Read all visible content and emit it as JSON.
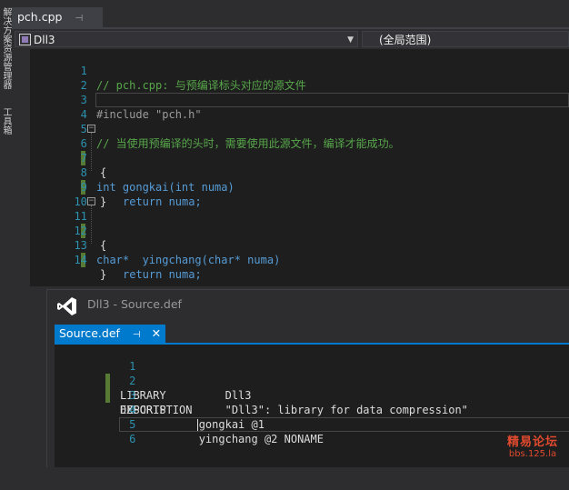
{
  "sidebar": {
    "items": [
      {
        "label": "解决方案资源管理器"
      },
      {
        "label": "工具箱"
      }
    ]
  },
  "doc_tab": {
    "label": "pch.cpp",
    "pin": "⊣"
  },
  "nav": {
    "project": "Dll3",
    "scope": "(全局范围)"
  },
  "code": {
    "lines": [
      {
        "n": "1",
        "text": "// pch.cpp: 与预编译标头对应的源文件"
      },
      {
        "n": "2",
        "text": ""
      },
      {
        "n": "3",
        "text": "#include \"pch.h\""
      },
      {
        "n": "4",
        "text": ""
      },
      {
        "n": "5",
        "text": "// 当使用预编译的头时，需要使用此源文件，编译才能成功。"
      },
      {
        "n": "6",
        "text": "int gongkai(int numa)"
      },
      {
        "n": "7",
        "text": "{"
      },
      {
        "n": "8",
        "text": "return numa;"
      },
      {
        "n": "9",
        "text": "}"
      },
      {
        "n": "10",
        "text": ""
      },
      {
        "n": "11",
        "text": "char*  yingchang(char* numa)"
      },
      {
        "n": "12",
        "text": "{"
      },
      {
        "n": "13",
        "text": "return numa;"
      },
      {
        "n": "14",
        "text": "}"
      }
    ]
  },
  "float_panel": {
    "title": "Dll3 - Source.def",
    "tab_label": "Source.def",
    "pin": "⊣",
    "close": "✕",
    "lines": [
      {
        "n": "1",
        "text": "LIBRARY         Dll3"
      },
      {
        "n": "2",
        "text": "DESCRIPTION     \"Dll3\": library for data compression\""
      },
      {
        "n": "3",
        "text": "EXPORTS"
      },
      {
        "n": "4",
        "text": "            gongkai @1"
      },
      {
        "n": "5",
        "text": "            yingchang @2 NONAME"
      },
      {
        "n": "6",
        "text": ""
      }
    ]
  },
  "watermark": {
    "line1": "精易论坛",
    "line2": "bbs.125.la"
  },
  "colors": {
    "accent": "#007acc",
    "comment": "#57a64a",
    "keyword": "#569cd6",
    "string": "#d69d85",
    "linenum": "#2b91af"
  },
  "icons": [
    "project-icon",
    "pin-icon",
    "close-icon",
    "fold-icon",
    "vs-logo-icon"
  ]
}
